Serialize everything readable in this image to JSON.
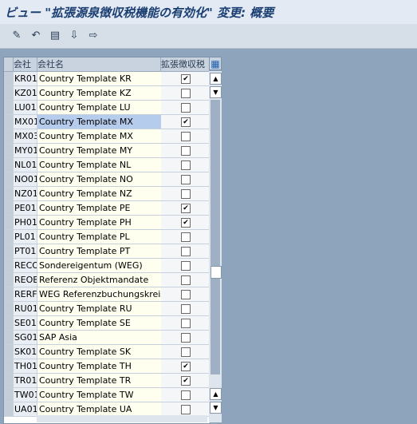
{
  "title": "ビュー \"拡張源泉徴収税機能の有効化\" 変更: 概要",
  "toolbar": {
    "icons": [
      "edit-glasses-icon",
      "undo-icon",
      "save-list-icon",
      "download-icon",
      "export-icon"
    ]
  },
  "table": {
    "headers": {
      "code": "会社",
      "name": "会社名",
      "ext": "拡張徴収税"
    },
    "rows": [
      {
        "code": "KR01",
        "name": "Country Template KR",
        "checked": true
      },
      {
        "code": "KZ01",
        "name": "Country Template KZ",
        "checked": false
      },
      {
        "code": "LU01",
        "name": "Country Template LU",
        "checked": false
      },
      {
        "code": "MX01",
        "name": "Country Template MX",
        "checked": true
      },
      {
        "code": "MX03",
        "name": "Country Template MX",
        "checked": false
      },
      {
        "code": "MY01",
        "name": "Country Template MY",
        "checked": false
      },
      {
        "code": "NL01",
        "name": "Country Template NL",
        "checked": false
      },
      {
        "code": "NO01",
        "name": "Country Template NO",
        "checked": false
      },
      {
        "code": "NZ01",
        "name": "Country Template NZ",
        "checked": false
      },
      {
        "code": "PE01",
        "name": "Country Template PE",
        "checked": true
      },
      {
        "code": "PH01",
        "name": "Country Template PH",
        "checked": true
      },
      {
        "code": "PL01",
        "name": "Country Template PL",
        "checked": false
      },
      {
        "code": "PT01",
        "name": "Country Template PT",
        "checked": false
      },
      {
        "code": "RECO",
        "name": "Sondereigentum (WEG)",
        "checked": false
      },
      {
        "code": "REOB",
        "name": "Referenz Objektmandate",
        "checked": false
      },
      {
        "code": "RERF",
        "name": "WEG Referenzbuchungskreis",
        "checked": false
      },
      {
        "code": "RU01",
        "name": "Country Template RU",
        "checked": false
      },
      {
        "code": "SE01",
        "name": "Country Template SE",
        "checked": false
      },
      {
        "code": "SG01",
        "name": "SAP Asia",
        "checked": false
      },
      {
        "code": "SK01",
        "name": "Country Template SK",
        "checked": false
      },
      {
        "code": "TH01",
        "name": "Country Template TH",
        "checked": true
      },
      {
        "code": "TR01",
        "name": "Country Template TR",
        "checked": true
      },
      {
        "code": "TW01",
        "name": "Country Template TW",
        "checked": false
      },
      {
        "code": "UA01",
        "name": "Country Template UA",
        "checked": false
      }
    ]
  }
}
